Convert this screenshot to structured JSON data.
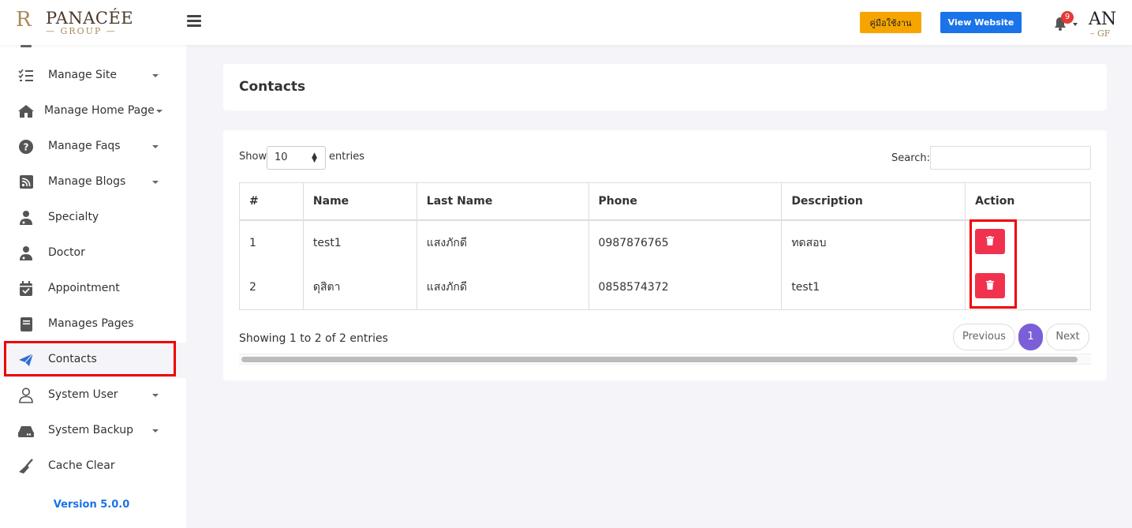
{
  "header": {
    "brand_monogram": "R",
    "brand_name": "PANACÉE",
    "brand_sub": "— GROUP —",
    "manual_button": "คู่มือใช้งาน",
    "website_button": "View Website",
    "notification_count": "9",
    "profile_logo_top": "AN",
    "profile_logo_bottom": "– GF"
  },
  "sidebar": {
    "items": [
      {
        "label": "Manage Site",
        "icon": "checklist-icon"
      },
      {
        "label": "Manage Home Page",
        "icon": "home-icon"
      },
      {
        "label": "Manage Faqs",
        "icon": "question-icon"
      },
      {
        "label": "Manage Blogs",
        "icon": "rss-icon"
      },
      {
        "label": "Specialty",
        "icon": "user-doctor-icon"
      },
      {
        "label": "Doctor",
        "icon": "user-doctor-icon"
      },
      {
        "label": "Appointment",
        "icon": "calendar-check-icon"
      },
      {
        "label": "Manages Pages",
        "icon": "book-icon"
      },
      {
        "label": "Contacts",
        "icon": "paper-plane-icon"
      },
      {
        "label": "System User",
        "icon": "user-icon"
      },
      {
        "label": "System Backup",
        "icon": "hdd-icon"
      },
      {
        "label": "Cache Clear",
        "icon": "broom-icon"
      }
    ],
    "version": "Version 5.0.0"
  },
  "page": {
    "title": "Contacts"
  },
  "table": {
    "show_label": "Show",
    "page_size": "10",
    "entries_label": "entries",
    "search_label": "Search:",
    "search_value": "",
    "columns": [
      "#",
      "Name",
      "Last Name",
      "Phone",
      "Description",
      "Action"
    ],
    "rows": [
      {
        "no": "1",
        "name": "test1",
        "last_name": "แสงภักดี",
        "phone": "0987876765",
        "description": "ทดสอบ"
      },
      {
        "no": "2",
        "name": "ดุสิตา",
        "last_name": "แสงภักดี",
        "phone": "0858574372",
        "description": "test1"
      }
    ],
    "info": "Showing 1 to 2 of 2 entries",
    "prev_label": "Previous",
    "current_page": "1",
    "next_label": "Next"
  },
  "colors": {
    "accent": "#7b5fd8",
    "danger": "#f0324f",
    "primary": "#1a73e8",
    "warning": "#f6a400",
    "highlight": "#e00000"
  }
}
